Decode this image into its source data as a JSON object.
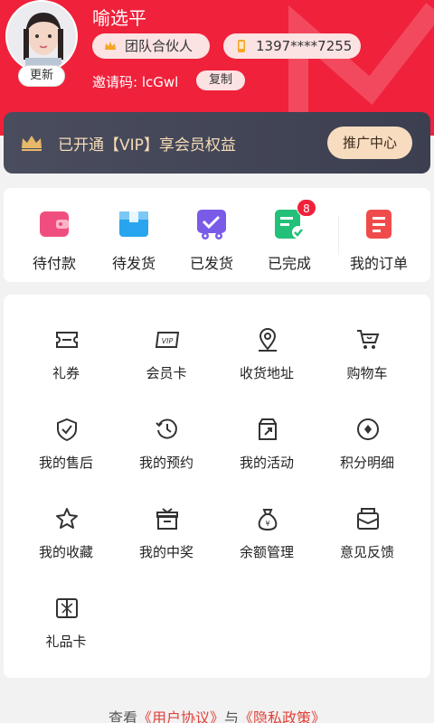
{
  "profile": {
    "avatar_update_label": "更新",
    "name": "喻选平",
    "role": "团队合伙人",
    "phone": "1397****7255",
    "invite_label": "邀请码: lcGwl",
    "copy_label": "复制"
  },
  "vip": {
    "text": "已开通【VIP】享会员权益",
    "promo_label": "推广中心"
  },
  "orders": {
    "items": [
      {
        "label": "待付款",
        "icon": "wallet-icon"
      },
      {
        "label": "待发货",
        "icon": "box-icon"
      },
      {
        "label": "已发货",
        "icon": "truck-icon"
      },
      {
        "label": "已完成",
        "icon": "completed-icon",
        "badge": "8"
      },
      {
        "label": "我的订单",
        "icon": "order-list-icon"
      }
    ]
  },
  "tools": {
    "items": [
      {
        "label": "礼券",
        "icon": "coupon-icon"
      },
      {
        "label": "会员卡",
        "icon": "vip-card-icon"
      },
      {
        "label": "收货地址",
        "icon": "location-icon"
      },
      {
        "label": "购物车",
        "icon": "cart-icon"
      },
      {
        "label": "我的售后",
        "icon": "shield-icon"
      },
      {
        "label": "我的预约",
        "icon": "clock-icon"
      },
      {
        "label": "我的活动",
        "icon": "activity-icon"
      },
      {
        "label": "积分明细",
        "icon": "points-icon"
      },
      {
        "label": "我的收藏",
        "icon": "star-icon"
      },
      {
        "label": "我的中奖",
        "icon": "gift-icon"
      },
      {
        "label": "余额管理",
        "icon": "money-bag-icon"
      },
      {
        "label": "意见反馈",
        "icon": "feedback-icon"
      },
      {
        "label": "礼品卡",
        "icon": "gift-card-icon"
      }
    ]
  },
  "footer": {
    "prefix": "查看",
    "user_agreement": "《用户协议》",
    "connector": "与",
    "privacy_policy": "《隐私政策》"
  },
  "colors": {
    "brand_red": "#f0213b",
    "vip_gold": "#f6dcb7",
    "card_dark": "#45485a"
  }
}
